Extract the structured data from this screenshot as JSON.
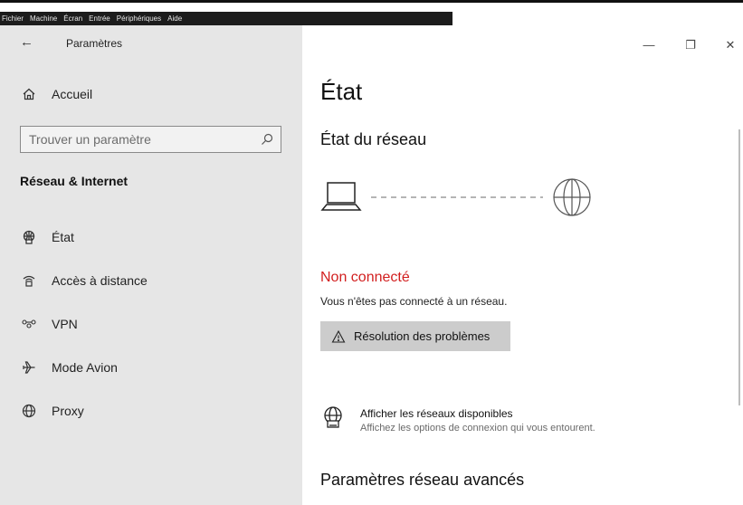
{
  "vm_menu": [
    "Fichier",
    "Machine",
    "Écran",
    "Entrée",
    "Périphériques",
    "Aide"
  ],
  "app": {
    "title": "Paramètres",
    "back_label": "←"
  },
  "window_controls": {
    "minimize": "—",
    "maximize": "❐",
    "close": "✕"
  },
  "sidebar": {
    "home": "Accueil",
    "search_placeholder": "Trouver un paramètre",
    "section": "Réseau & Internet",
    "items": [
      {
        "label": "État",
        "icon": "network-status-icon"
      },
      {
        "label": "Accès à distance",
        "icon": "dialup-icon"
      },
      {
        "label": "VPN",
        "icon": "vpn-icon"
      },
      {
        "label": "Mode Avion",
        "icon": "airplane-icon"
      },
      {
        "label": "Proxy",
        "icon": "globe-icon"
      }
    ]
  },
  "main": {
    "title": "État",
    "network_section": "État du réseau",
    "status_title": "Non connecté",
    "status_desc": "Vous n'êtes pas connecté à un réseau.",
    "troubleshoot_label": "Résolution des problèmes",
    "show_networks_title": "Afficher les réseaux disponibles",
    "show_networks_desc": "Affichez les options de connexion qui vous entourent.",
    "advanced_title": "Paramètres réseau avancés"
  },
  "colors": {
    "error": "#d21f1f",
    "sidebar_bg": "#e6e6e6",
    "button_bg": "#cccccc"
  }
}
